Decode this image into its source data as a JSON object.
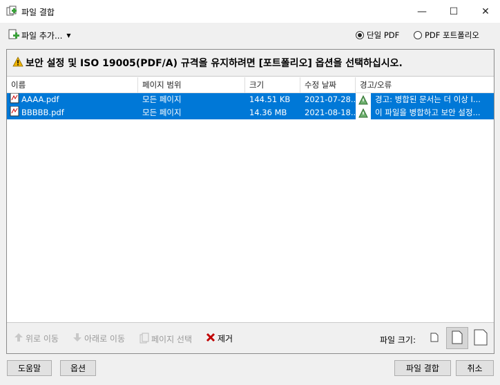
{
  "window": {
    "title": "파일 결합",
    "minimize": "—",
    "maximize": "☐",
    "close": "✕"
  },
  "toolbar": {
    "add_file_label": "파일 추가...",
    "radio_single": "단일 PDF",
    "radio_portfolio": "PDF 포트폴리오",
    "selected": "single"
  },
  "warning": {
    "icon": "warning-icon",
    "text": "보안 설정 및 ISO 19005(PDF/A) 규격을 유지하려면 [포트폴리오] 옵션을 선택하십시오."
  },
  "table": {
    "columns": [
      "이름",
      "페이지 범위",
      "크기",
      "수정 날짜",
      "경고/오류"
    ],
    "rows": [
      {
        "name": "AAAA.pdf",
        "range": "모든 페이지",
        "size": "144.51 KB",
        "date": "2021-07-28...",
        "warning": "경고:  병합된 문서는 더 이상 I..."
      },
      {
        "name": "BBBBB.pdf",
        "range": "모든 페이지",
        "size": "14.36 MB",
        "date": "2021-08-18...",
        "warning": "이 파일을 병합하고 보안 설정..."
      }
    ]
  },
  "actions": {
    "move_up": "위로 이동",
    "move_down": "아래로 이동",
    "choose_pages": "페이지 선택",
    "remove": "제거",
    "file_size_label": "파일 크기:"
  },
  "footer": {
    "help": "도움말",
    "options": "옵션",
    "combine": "파일 결합",
    "cancel": "취소"
  },
  "colors": {
    "selection": "#0078d7",
    "remove_icon": "#c00000",
    "warning_icon": "#f0b400"
  }
}
